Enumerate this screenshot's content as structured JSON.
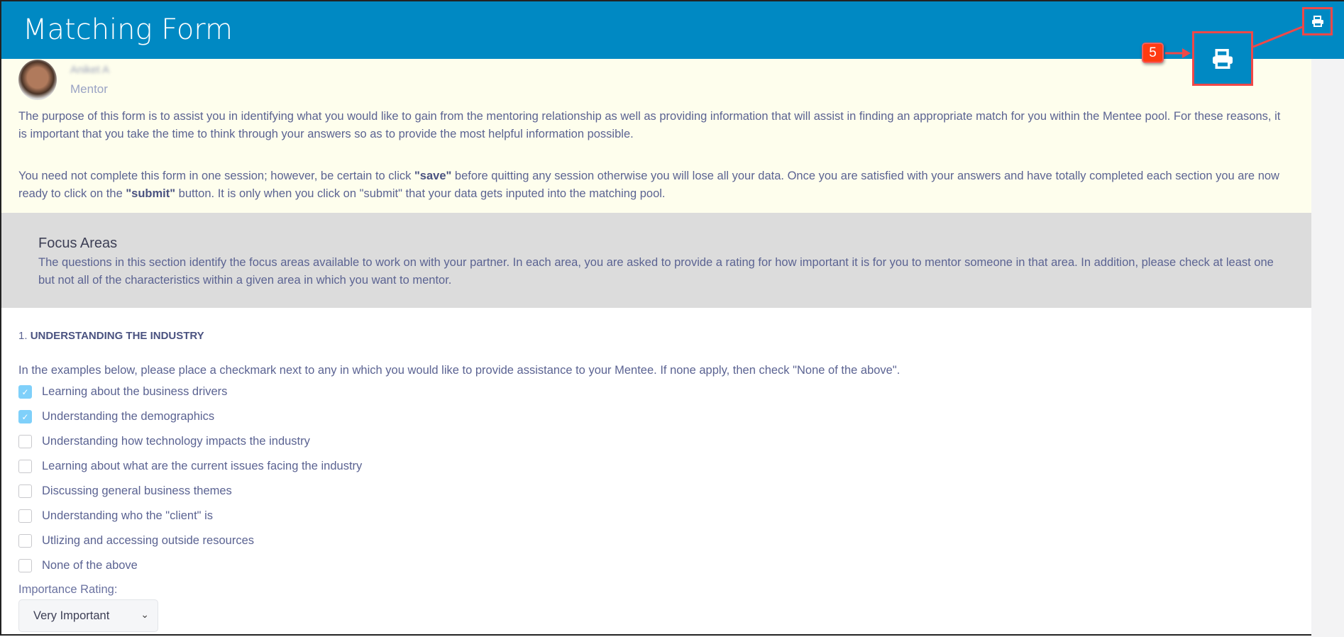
{
  "header": {
    "title": "Matching Form",
    "print_icon": "printer-icon"
  },
  "annotation": {
    "badge": "5",
    "color": "#f04848"
  },
  "profile": {
    "name": "Aniket A",
    "role": "Mentor"
  },
  "intro": {
    "p1": "The purpose of this form is to assist you in identifying what you would like to gain from the mentoring relationship as well as providing information that will assist in finding an appropriate match for you within the Mentee pool.  For these reasons, it is important that you take the time to think through your answers so as to provide the most helpful information possible.",
    "p2_a": "You need not complete this form in one session; however, be certain to click ",
    "p2_save": "\"save\"",
    "p2_b": " before quitting any session otherwise you will lose all your data.  Once you are satisfied with your answers and have totally completed each section you are now ready to click on the ",
    "p2_submit": "\"submit\"",
    "p2_c": " button. It is only when you click on \"submit\" that your data gets inputed into the matching pool."
  },
  "section": {
    "title": "Focus Areas",
    "description": "The questions in this section identify the focus areas available to work on with your partner. In each area, you are asked to provide a rating for how important it is for you to mentor someone in that area. In addition, please check at least one but not all of the characteristics within a given area in which you want to mentor."
  },
  "question": {
    "number": "1.",
    "title": "UNDERSTANDING THE INDUSTRY",
    "instruction": "In the examples below, please place a checkmark next to any in which you would like to provide assistance to your Mentee. If none apply, then check \"None of the above\".",
    "options": [
      {
        "label": "Learning about the business drivers",
        "checked": true
      },
      {
        "label": "Understanding the demographics",
        "checked": true
      },
      {
        "label": "Understanding how technology impacts the industry",
        "checked": false
      },
      {
        "label": "Learning about what are the current issues facing the industry",
        "checked": false
      },
      {
        "label": "Discussing general business themes",
        "checked": false
      },
      {
        "label": "Understanding who the \"client\" is",
        "checked": false
      },
      {
        "label": "Utlizing and accessing outside resources",
        "checked": false
      },
      {
        "label": "None of the above",
        "checked": false
      }
    ],
    "rating_label": "Importance Rating:",
    "rating_value": "Very Important"
  }
}
